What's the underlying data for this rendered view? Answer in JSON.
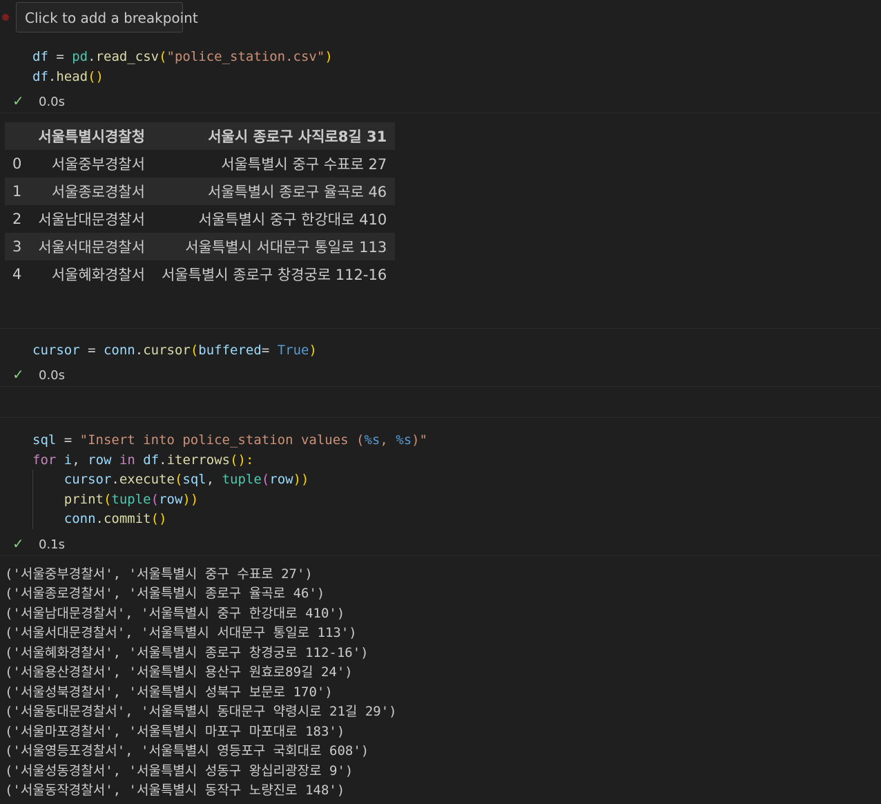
{
  "breakpoint": {
    "tooltip": "Click to add a breakpoint"
  },
  "cell1": {
    "status": {
      "check": "✓",
      "time": "0.0s"
    },
    "table": {
      "columns": [
        "",
        "서울특별시경찰청",
        "서울시 종로구 사직로8길 31"
      ],
      "rows": [
        [
          "0",
          "서울중부경찰서",
          "서울특별시 중구 수표로 27"
        ],
        [
          "1",
          "서울종로경찰서",
          "서울특별시 종로구 율곡로 46"
        ],
        [
          "2",
          "서울남대문경찰서",
          "서울특별시 중구 한강대로 410"
        ],
        [
          "3",
          "서울서대문경찰서",
          "서울특별시 서대문구 통일로 113"
        ],
        [
          "4",
          "서울혜화경찰서",
          "서울특별시 종로구 창경궁로 112-16"
        ]
      ]
    }
  },
  "cell2": {
    "status": {
      "check": "✓",
      "time": "0.0s"
    }
  },
  "cell3": {
    "status": {
      "check": "✓",
      "time": "0.1s"
    },
    "output": [
      "('서울중부경찰서', '서울특별시 중구 수표로 27')",
      "('서울종로경찰서', '서울특별시 종로구 율곡로 46')",
      "('서울남대문경찰서', '서울특별시 중구 한강대로 410')",
      "('서울서대문경찰서', '서울특별시 서대문구 통일로 113')",
      "('서울혜화경찰서', '서울특별시 종로구 창경궁로 112-16')",
      "('서울용산경찰서', '서울특별시 용산구 원효로89길 24')",
      "('서울성북경찰서', '서울특별시 성북구 보문로 170')",
      "('서울동대문경찰서', '서울특별시 동대문구 약령시로 21길 29')",
      "('서울마포경찰서', '서울특별시 마포구 마포대로 183')",
      "('서울영등포경찰서', '서울특별시 영등포구 국회대로 608')",
      "('서울성동경찰서', '서울특별시 성동구 왕십리광장로 9')",
      "('서울동작경찰서', '서울특별시 동작구 노량진로 148')"
    ]
  },
  "code": {
    "c1l1": {
      "t1": "df",
      "t2": " = ",
      "t3": "pd",
      "t4": ".",
      "t5": "read_csv",
      "t6": "(",
      "t7": "\"police_station.csv\"",
      "t8": ")"
    },
    "c1l2": {
      "t1": "df",
      "t2": ".",
      "t3": "head",
      "t4": "()"
    },
    "c2l1": {
      "t1": "cursor",
      "t2": " = ",
      "t3": "conn",
      "t4": ".",
      "t5": "cursor",
      "t6": "(",
      "t7": "buffered",
      "t8": "= ",
      "t9": "True",
      "t10": ")"
    },
    "c3l1": {
      "t1": "sql",
      "t2": " = ",
      "t3": "\"Insert into police_station values (",
      "t4": "%s",
      "t5": ", ",
      "t6": "%s",
      "t7": ")\""
    },
    "c3l2": {
      "t1": "for",
      "t2": " ",
      "t3": "i",
      "t4": ", ",
      "t5": "row",
      "t6": " ",
      "t7": "in",
      "t8": " ",
      "t9": "df",
      "t10": ".",
      "t11": "iterrows",
      "t12": "():"
    },
    "c3l3": {
      "t1": "    ",
      "t2": "cursor",
      "t3": ".",
      "t4": "execute",
      "t5": "(",
      "t6": "sql",
      "t7": ", ",
      "t8": "tuple",
      "t9": "(",
      "t10": "row",
      "t11": "))"
    },
    "c3l4": {
      "t1": "    ",
      "t2": "print",
      "t3": "(",
      "t4": "tuple",
      "t5": "(",
      "t6": "row",
      "t7": "))"
    },
    "c3l5": {
      "t1": "    ",
      "t2": "conn",
      "t3": ".",
      "t4": "commit",
      "t5": "()"
    }
  }
}
